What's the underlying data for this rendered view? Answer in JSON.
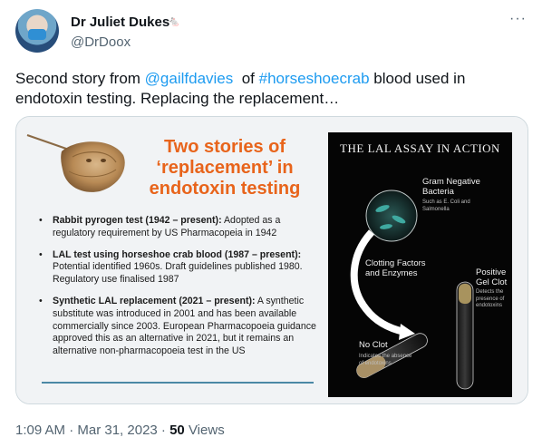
{
  "author": {
    "name": "Dr Juliet Dukes",
    "handle": "@DrDoox",
    "badge_icon": "mouse-icon"
  },
  "tweet": {
    "part1": "Second story from ",
    "mention": "@gailfdavies",
    "part2": "  of ",
    "hashtag": "#horseshoecrab",
    "part3": " blood used in endotoxin testing. Replacing the replacement…",
    "link_color": "#1d9bf0"
  },
  "slide": {
    "title": "Two stories of ‘replacement’ in endotoxin testing",
    "title_color": "#e8641b",
    "bullets": [
      {
        "bold": "Rabbit pyrogen test (1942 – present):",
        "text": " Adopted as a regulatory requirement by US Pharmacopeia in 1942"
      },
      {
        "bold": "LAL test using horseshoe crab blood (1987 – present):",
        "text": " Potential identified 1960s. Draft guidelines published 1980. Regulatory use finalised 1987"
      },
      {
        "bold": "Synthetic LAL replacement (2021 – present):",
        "text": " A synthetic substitute was introduced in 2001 and has been available commercially since 2003. European Pharmacopoeia guidance approved this as an alternative in 2021, but it remains an alternative non-pharmacopoeia test in the US"
      }
    ],
    "panel": {
      "title": "THE LAL ASSAY IN ACTION",
      "gram_negative": "Gram Negative Bacteria",
      "gram_examples": "Such as E. Coli and Salmonella",
      "clotting": "Clotting Factors and Enzymes",
      "positive": "Positive Gel Clot",
      "positive_note": "Detects the presence of endotoxins",
      "no_clot": "No Clot",
      "no_clot_note": "Indicates the absence of endotoxins"
    }
  },
  "meta": {
    "timestamp": "1:09 AM · Mar 31, 2023 · ",
    "views_count": "50",
    "views_label": " Views"
  }
}
